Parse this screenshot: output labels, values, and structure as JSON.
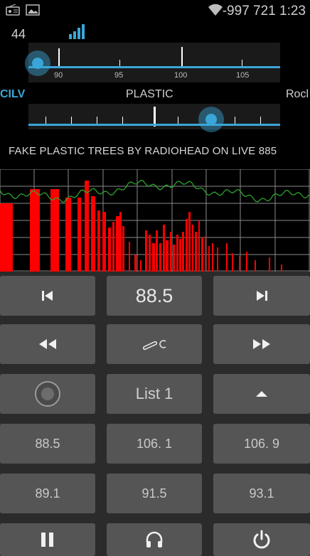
{
  "status_bar": {
    "left_icons": [
      "radio-icon",
      "image-icon"
    ],
    "right_icons": [
      "wifi-icon"
    ],
    "info_text": "-997 721 1:23"
  },
  "signal": {
    "value": "44",
    "icon": "signal-bars-icon"
  },
  "tuner": {
    "scale_labels": [
      "90",
      "95",
      "100",
      "105"
    ],
    "current_pointer": "88.5"
  },
  "stations": {
    "previous": "CILV",
    "current": "PLASTIC",
    "next": "Rocl"
  },
  "rds_text": "FAKE PLASTIC TREES BY RADIOHEAD ON LIVE 885",
  "colors": {
    "accent": "#3aa6d8",
    "spectrum_bars": "#ff0000",
    "waveform": "#2fae2f",
    "button_bg": "#555555"
  },
  "controls": {
    "prev_icon": "skip-previous-icon",
    "frequency": "88.5",
    "next_icon": "skip-next-icon",
    "rewind_icon": "rewind-icon",
    "tune_icon": "tune-icon",
    "fast_forward_icon": "fast-forward-icon",
    "record_icon": "record-icon",
    "list_label": "List 1",
    "up_icon": "arrow-up-icon",
    "pause_icon": "pause-icon",
    "headphones_icon": "headphones-icon",
    "power_icon": "power-icon"
  },
  "presets": [
    "88.5",
    "106. 1",
    "106. 9",
    "89.1",
    "91.5",
    "93.1"
  ]
}
